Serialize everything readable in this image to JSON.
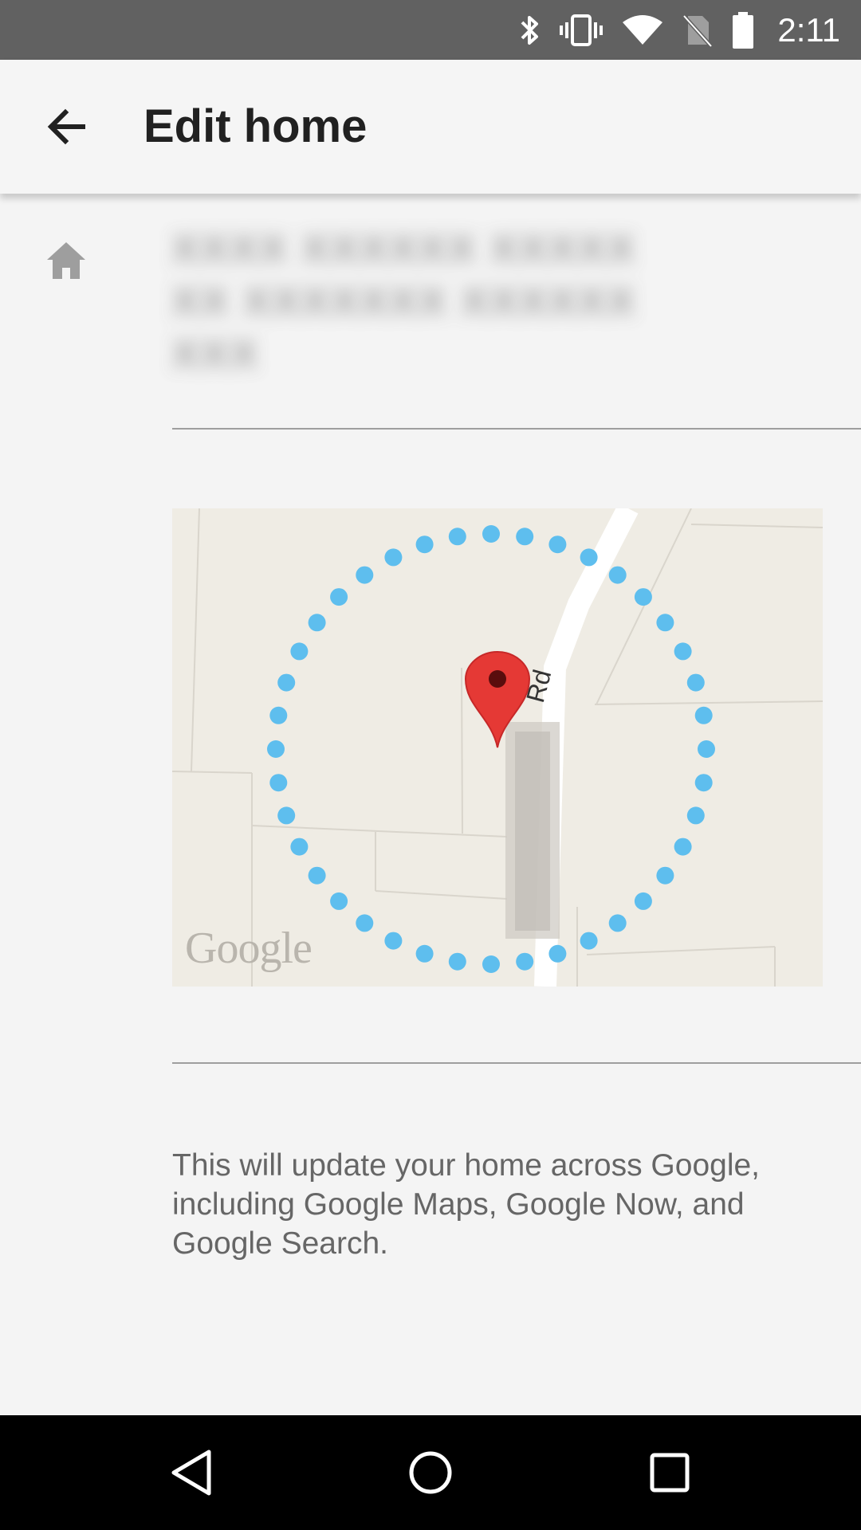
{
  "status_bar": {
    "time": "2:11",
    "icons": [
      "bluetooth-icon",
      "vibrate-icon",
      "wifi-icon",
      "no-sim-icon",
      "battery-icon"
    ],
    "background": "#616161"
  },
  "app_bar": {
    "title": "Edit home",
    "back_icon": "arrow-back-icon"
  },
  "address": {
    "icon": "home-icon",
    "value": "XXXX XXXXXX XXXXX XX XXXXXXX XXXXXX XXX",
    "note": "blurred"
  },
  "map": {
    "logo": "Google",
    "road_label": "Rd",
    "marker_color": "#e53935",
    "radius_dot_color": "#5ebeee",
    "background": "#efece4"
  },
  "info": {
    "text": "This will update your home across Google, including Google Maps, Google Now, and Google Search."
  },
  "nav_bar": {
    "back_icon": "nav-back-icon",
    "home_icon": "nav-home-icon",
    "recents_icon": "nav-recents-icon"
  }
}
